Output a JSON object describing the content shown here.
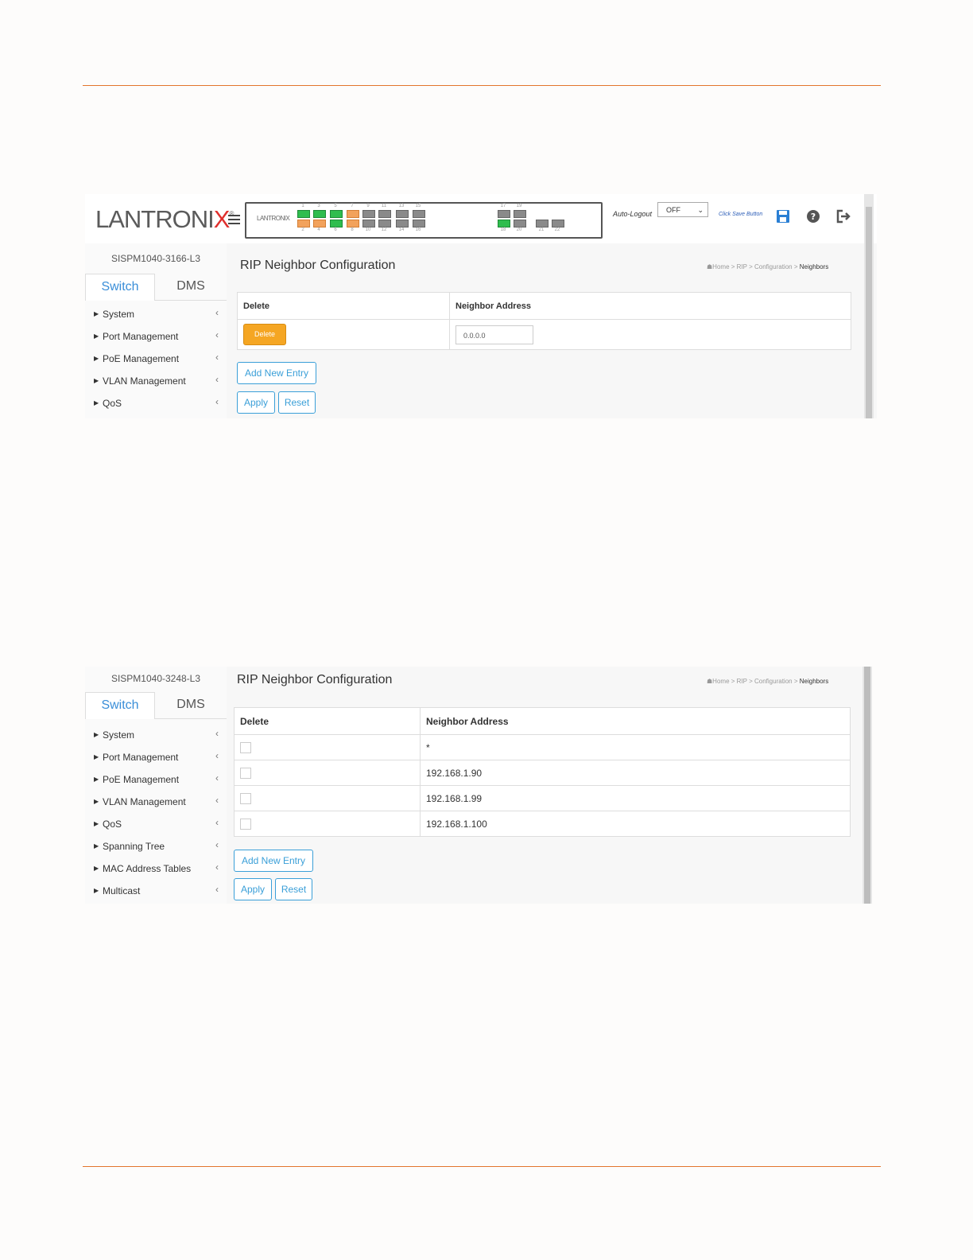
{
  "screen1": {
    "brand": {
      "logo_main": "LANTRONI",
      "logo_x": "X",
      "logo_reg": "®",
      "panel_logo": "LANTRONIX"
    },
    "ports_top": [
      "1",
      "3",
      "5",
      "7",
      "9",
      "11",
      "13",
      "15"
    ],
    "ports_bottom": [
      "2",
      "4",
      "6",
      "8",
      "10",
      "12",
      "14",
      "16"
    ],
    "ports_sfp_top": [
      "17",
      "19"
    ],
    "ports_sfp_bottom": [
      "18",
      "20",
      "21",
      "22"
    ],
    "auto_logout_label": "Auto-Logout",
    "auto_logout_value": "OFF",
    "save_hint": "Click Save Button",
    "model": "SISPM1040-3166-L3",
    "tabs": [
      "Switch",
      "DMS"
    ],
    "nav": [
      "System",
      "Port Management",
      "PoE Management",
      "VLAN Management",
      "QoS"
    ],
    "page_title": "RIP Neighbor Configuration",
    "breadcrumb": [
      "Home",
      "RIP",
      "Configuration",
      "Neighbors"
    ],
    "breadcrumb_sep": ">",
    "table_headers": [
      "Delete",
      "Neighbor Address"
    ],
    "delete_button": "Delete",
    "neighbor_input": "0.0.0.0",
    "add_new_entry": "Add New Entry",
    "apply": "Apply",
    "reset": "Reset",
    "colors": {
      "accent": "#3a8ed8",
      "delete_button": "#f5a623",
      "rule": "#e3752c",
      "port_up": "#2fbd4e",
      "port_poe": "#f2a25c"
    }
  },
  "screen2": {
    "model": "SISPM1040-3248-L3",
    "tabs": [
      "Switch",
      "DMS"
    ],
    "nav": [
      "System",
      "Port Management",
      "PoE Management",
      "VLAN Management",
      "QoS",
      "Spanning Tree",
      "MAC Address Tables",
      "Multicast"
    ],
    "page_title": "RIP Neighbor Configuration",
    "breadcrumb": [
      "Home",
      "RIP",
      "Configuration",
      "Neighbors"
    ],
    "breadcrumb_sep": ">",
    "table_headers": [
      "Delete",
      "Neighbor Address"
    ],
    "rows": [
      "*",
      "192.168.1.90",
      "192.168.1.99",
      "192.168.1.100"
    ],
    "add_new_entry": "Add New Entry",
    "apply": "Apply",
    "reset": "Reset"
  }
}
